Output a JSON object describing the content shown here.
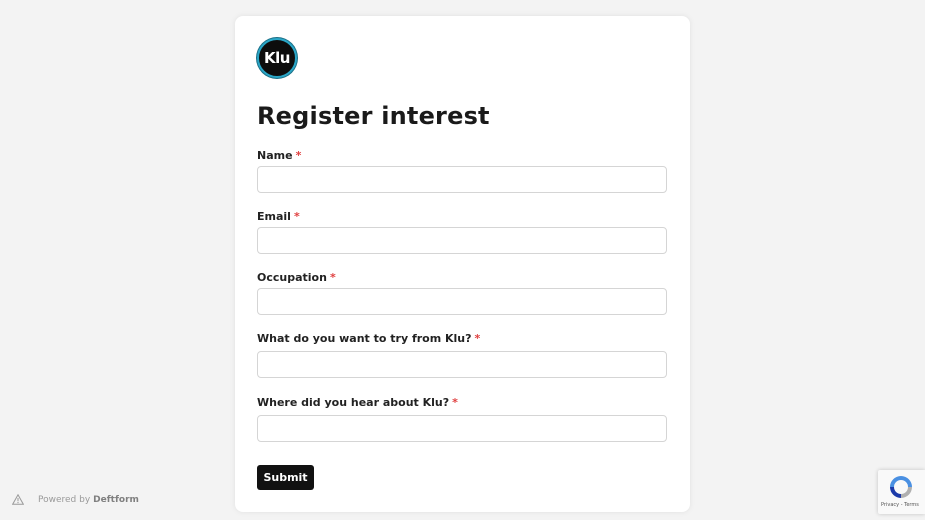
{
  "form": {
    "logo_text": "Klu",
    "title": "Register interest",
    "required_marker": "*",
    "fields": [
      {
        "label": "Name",
        "value": "",
        "placeholder": ""
      },
      {
        "label": "Email",
        "value": "",
        "placeholder": ""
      },
      {
        "label": "Occupation",
        "value": "",
        "placeholder": ""
      },
      {
        "label": "What do you want to try from Klu?",
        "value": "",
        "placeholder": ""
      },
      {
        "label": "Where did you hear about Klu?",
        "value": "",
        "placeholder": ""
      }
    ],
    "submit_label": "Submit"
  },
  "footer": {
    "powered_prefix": "Powered by",
    "powered_brand": "Deftform"
  },
  "recaptcha": {
    "privacy": "Privacy",
    "separator": "-",
    "terms": "Terms"
  },
  "icons": {
    "logo": "klu-logo-icon",
    "warning": "warning-triangle-icon",
    "recaptcha": "recaptcha-icon"
  },
  "colors": {
    "background": "#f3f3f3",
    "card": "#ffffff",
    "button": "#111111",
    "required": "#e04040",
    "logo_ring": "#2aa6c7"
  }
}
